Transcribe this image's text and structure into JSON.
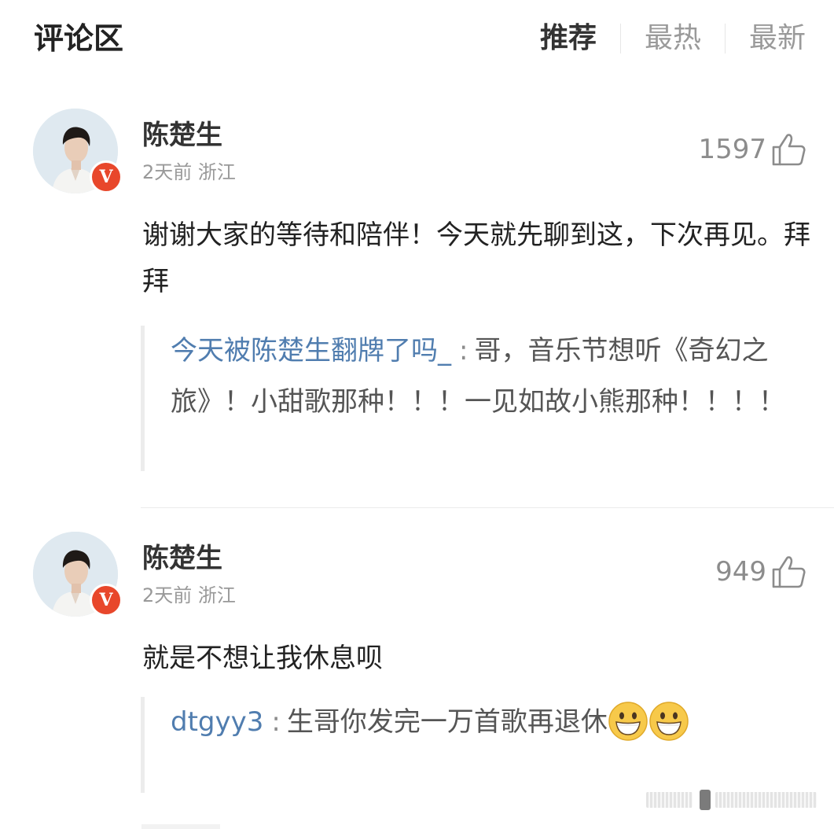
{
  "header": {
    "title": "评论区",
    "tabs": [
      {
        "label": "推荐",
        "active": true
      },
      {
        "label": "最热",
        "active": false
      },
      {
        "label": "最新",
        "active": false
      }
    ]
  },
  "comments": [
    {
      "username": "陈楚生",
      "verified_badge": "V",
      "meta": "2天前 浙江",
      "likes": "1597",
      "text": "谢谢大家的等待和陪伴！今天就先聊到这，下次再见。拜拜",
      "reply": {
        "user": "今天被陈楚生翻牌了吗_",
        "separator": ":",
        "text": "哥，音乐节想听《奇幻之旅》！小甜歌那种！！！一见如故小熊那种！！！！"
      }
    },
    {
      "username": "陈楚生",
      "verified_badge": "V",
      "meta": "2天前 浙江",
      "likes": "949",
      "text": "就是不想让我休息呗",
      "reply": {
        "user": "dtgyy3",
        "separator": ":",
        "text": "生哥你发完一万首歌再退休",
        "emoji_icon": "grinning-face-emoji"
      }
    }
  ],
  "colors": {
    "reply_user": "#507daf",
    "verified_badge": "#e8472b",
    "muted_text": "#999999"
  }
}
